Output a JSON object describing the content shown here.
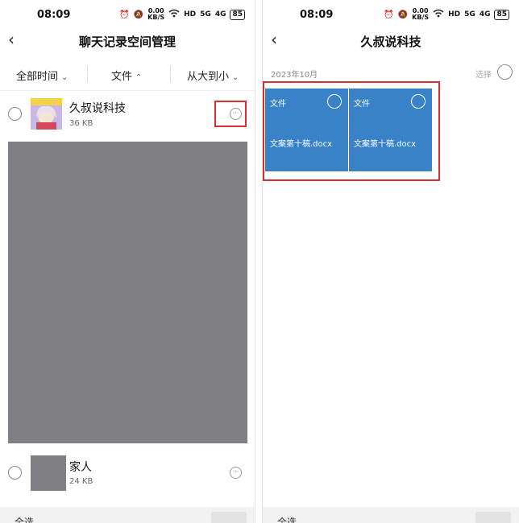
{
  "left_screen": {
    "status": {
      "time": "08:09",
      "net_speed_value": "0.00",
      "net_speed_unit": "KB/S",
      "hd": "HD",
      "sig1": "5G",
      "sig2": "4G",
      "battery": "85"
    },
    "header": {
      "title": "聊天记录空间管理"
    },
    "filters": {
      "time": "全部时间",
      "type": "文件",
      "sort": "从大到小"
    },
    "items": [
      {
        "name": "久叔说科技",
        "size": "36 KB"
      },
      {
        "name": "家人",
        "size": "24 KB"
      }
    ],
    "bottom": {
      "select_all": "全选"
    }
  },
  "right_screen": {
    "status": {
      "time": "08:09",
      "net_speed_value": "0.00",
      "net_speed_unit": "KB/S",
      "hd": "HD",
      "sig1": "5G",
      "sig2": "4G",
      "battery": "85"
    },
    "header": {
      "title": "久叔说科技"
    },
    "month": "2023年10月",
    "select_label": "选择",
    "files": [
      {
        "type": "文件",
        "name": "文案第十稿.docx"
      },
      {
        "type": "文件",
        "name": "文案第十稿.docx"
      }
    ],
    "bottom": {
      "select_all": "全选"
    }
  },
  "colors": {
    "highlight": "#d62f2f",
    "file_card": "#3a82c8",
    "gray_block": "#808084"
  }
}
